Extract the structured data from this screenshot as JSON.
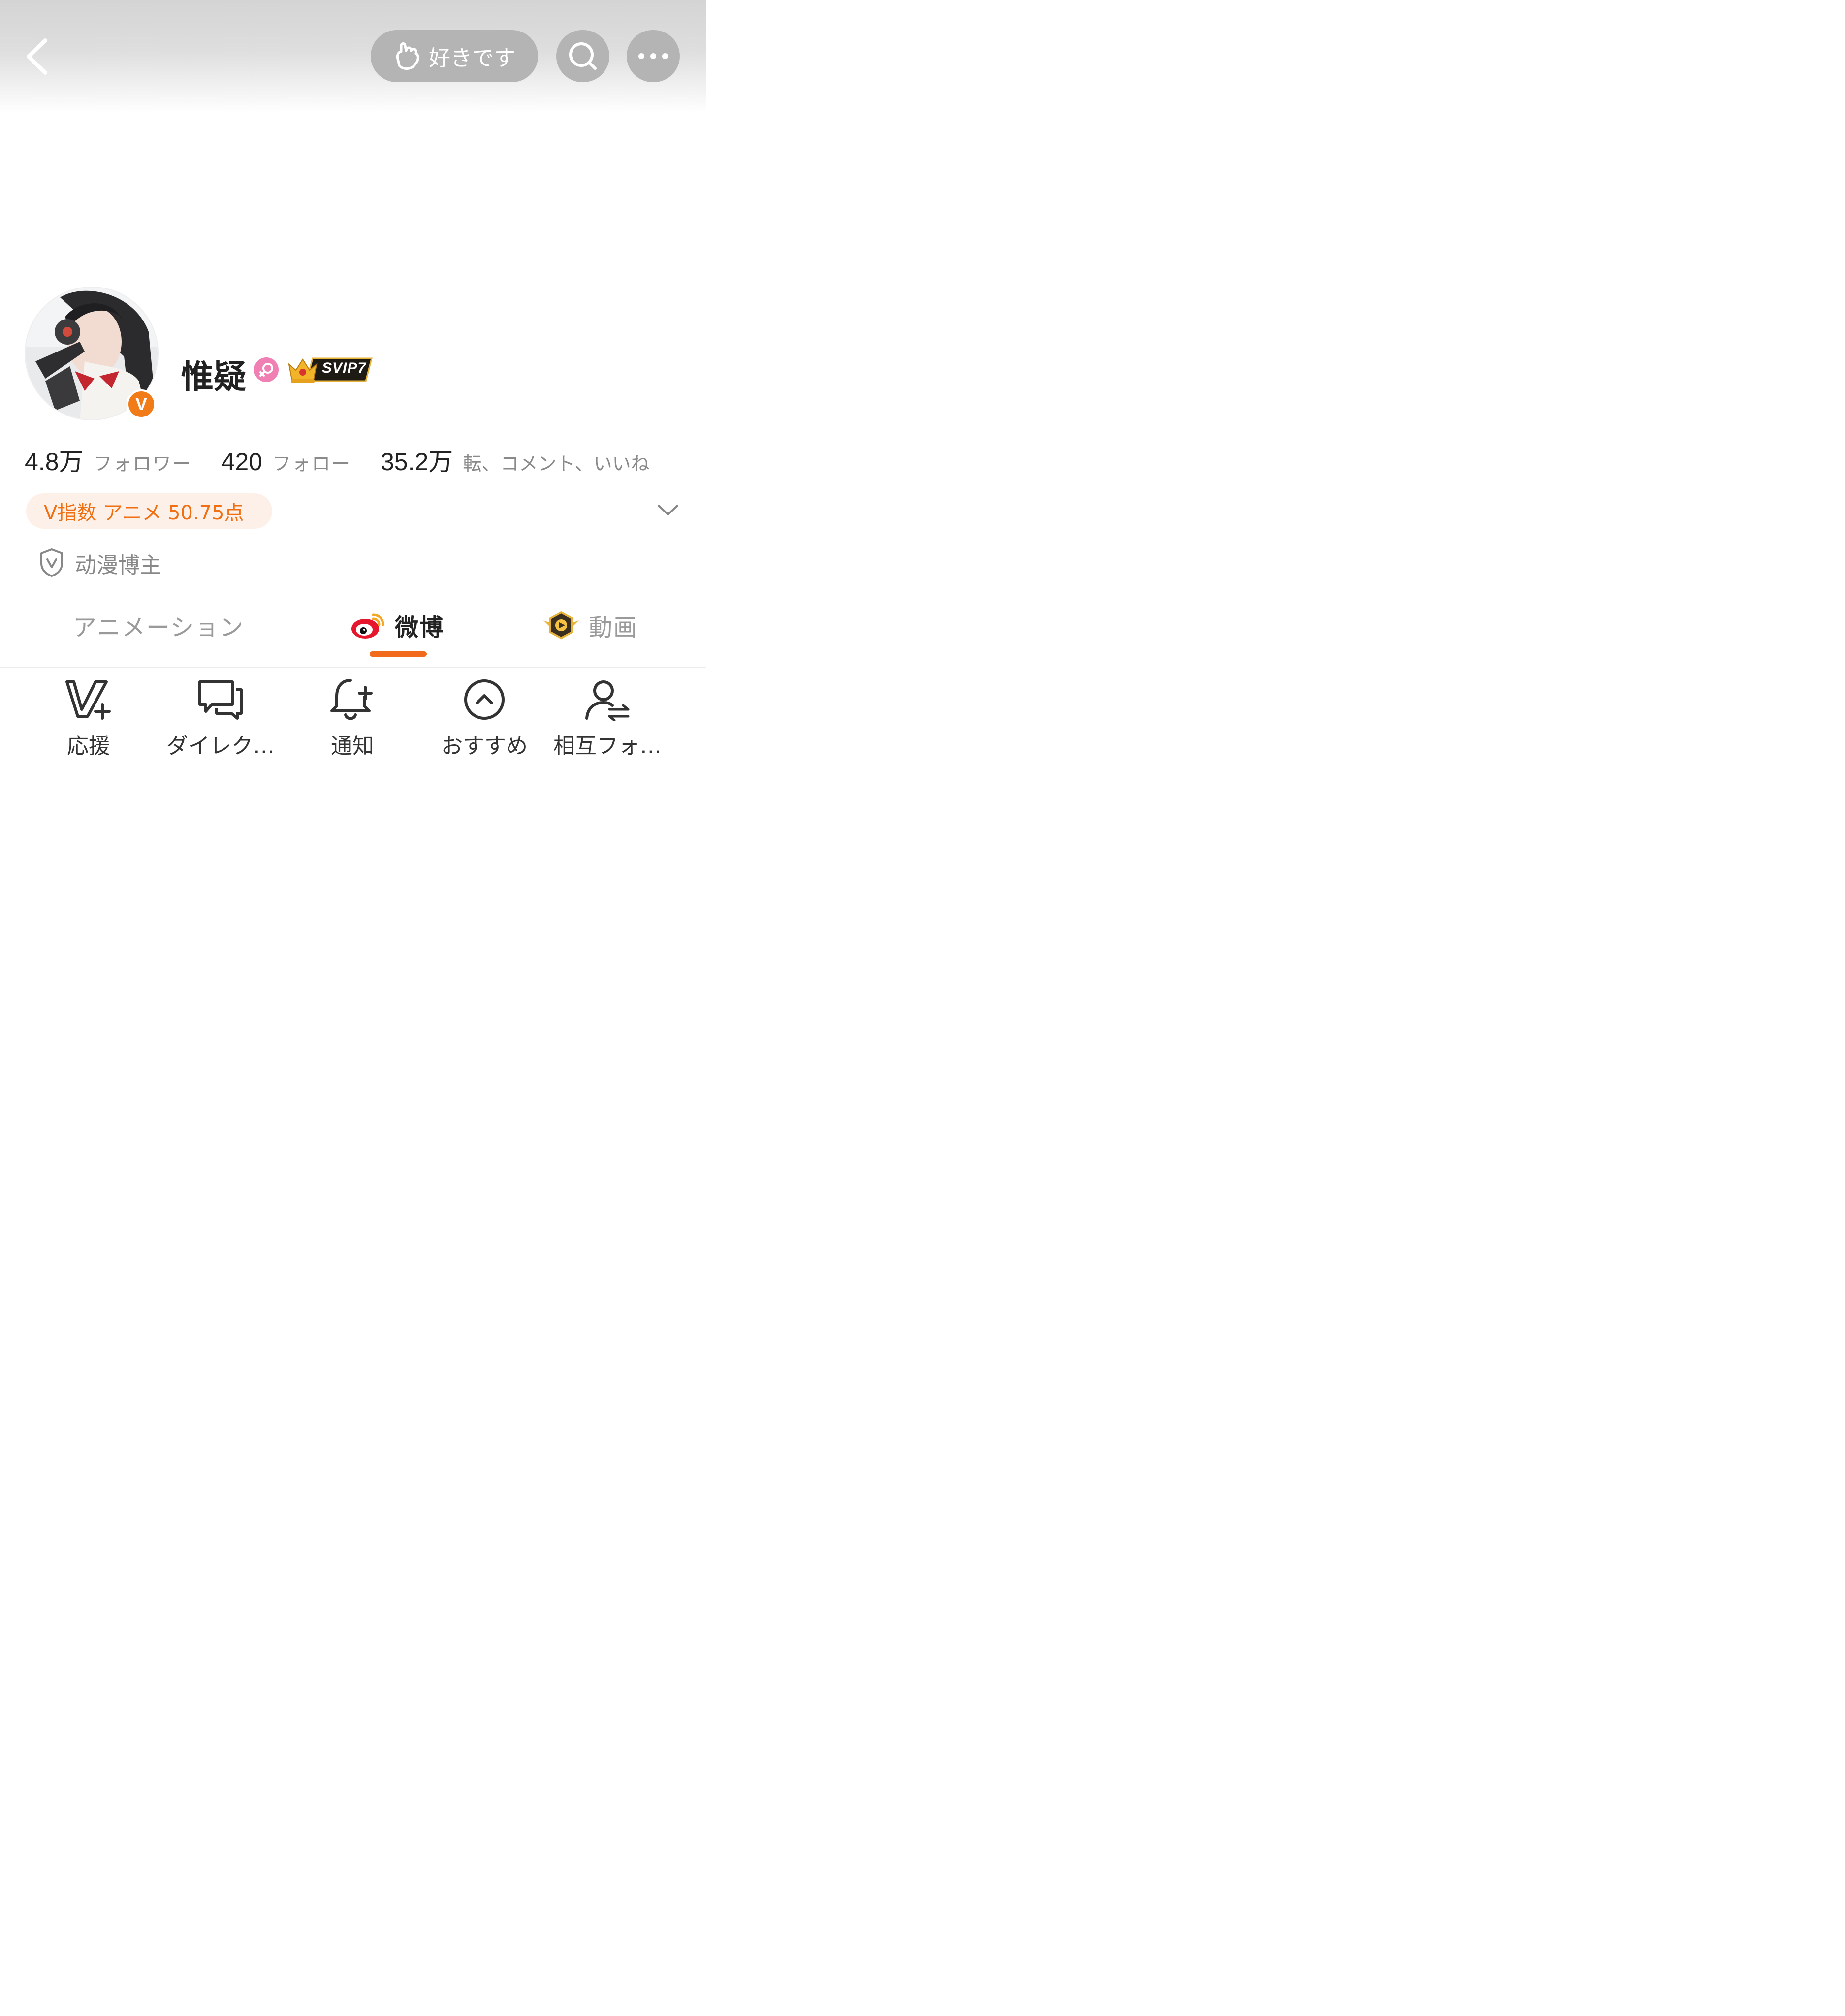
{
  "header": {
    "like_label": "好きです",
    "back_icon": "chevron-left-icon",
    "search_icon": "search-icon",
    "more_icon": "more-icon"
  },
  "profile": {
    "name": "惟疑",
    "verified_badge": "V",
    "gender": "female",
    "vip_label": "SVIP7"
  },
  "stats": [
    {
      "value": "4.8万",
      "label": "フォロワー"
    },
    {
      "value": "420",
      "label": "フォロー"
    },
    {
      "value": "35.2万",
      "label": "転、コメント、いいね"
    }
  ],
  "v_index": "V指数 アニメ 50.75点",
  "certification": "动漫博主",
  "tabs": [
    {
      "label": "アニメーション",
      "active": false
    },
    {
      "label": "微博",
      "active": true
    },
    {
      "label": "動画",
      "active": false
    }
  ],
  "actions": [
    {
      "label": "応援",
      "icon": "v-plus-icon"
    },
    {
      "label": "ダイレク…",
      "icon": "chat-icon"
    },
    {
      "label": "通知",
      "icon": "bell-plus-icon"
    },
    {
      "label": "おすすめ",
      "icon": "circle-chevron-up-icon"
    },
    {
      "label": "相互フォ…",
      "icon": "user-exchange-icon"
    }
  ],
  "colors": {
    "accent": "#f26a1b",
    "vindex_bg": "#fdf0e8",
    "header_button_bg": "#b4b4b4",
    "gender_badge": "#f07fb4"
  }
}
